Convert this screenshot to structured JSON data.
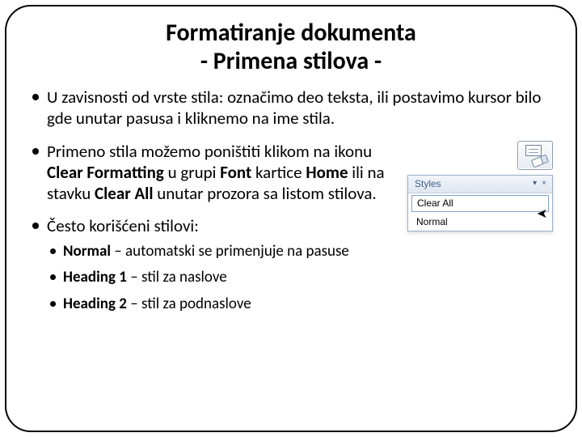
{
  "title_line1": "Formatiranje dokumenta",
  "title_line2": "- Primena stilova -",
  "bullets": {
    "b1": "U zavisnosti od vrste stila: označimo deo teksta, ili postavimo kursor bilo gde unutar pasusa i kliknemo na ime stila.",
    "b2_pre": "Primeno stila možemo poništiti klikom na ikonu ",
    "b2_cf": "Clear Formatting",
    "b2_mid": " u grupi ",
    "b2_font": "Font",
    "b2_mid2": " kartice ",
    "b2_home": "Home",
    "b2_mid3": " ili na stavku ",
    "b2_ca": "Clear All",
    "b2_post": " unutar prozora sa listom stilova.",
    "b3": "Često korišćeni stilovi:",
    "s1_b": "Normal",
    "s1_t": " – automatski se primenjuje na pasuse",
    "s2_b": "Heading 1",
    "s2_t": " – stil za naslove",
    "s3_b": "Heading 2",
    "s3_t": " – stil za podnaslove"
  },
  "styles_panel": {
    "title": "Styles",
    "item_clear_all": "Clear All",
    "item_normal": "Normal",
    "down": "▾",
    "close": "×"
  }
}
